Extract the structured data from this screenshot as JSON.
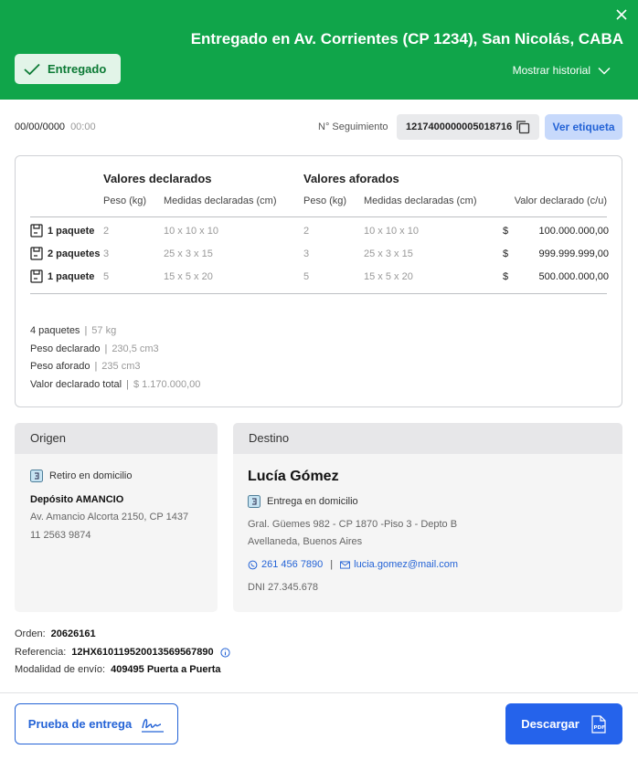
{
  "header": {
    "title": "Entregado en Av. Corrientes (CP 1234), San Nicolás, CABA",
    "status": "Entregado",
    "history_link": "Mostrar historial",
    "accent_color": "#10a54a"
  },
  "info": {
    "date": "00/00/0000",
    "time": "00:00",
    "tracking_label": "N° Seguimiento",
    "tracking_number": "1217400000005018716",
    "label_button": "Ver etiqueta"
  },
  "packages": {
    "group_declared": "Valores declarados",
    "group_appraised": "Valores aforados",
    "col_weight": "Peso (kg)",
    "col_dimensions": "Medidas declaradas (cm)",
    "col_weight_2": "Peso (kg)",
    "col_dimensions_2": "Medidas declaradas (cm)",
    "col_value": "Valor declarado (c/u)",
    "rows": [
      {
        "label": "1 paquete",
        "weight": "2",
        "dims": "10 x 10 x 10",
        "weight2": "2",
        "dims2": "10 x 10 x 10",
        "currency": "$",
        "value": "100.000.000,00"
      },
      {
        "label": "2 paquetes",
        "weight": "3",
        "dims": "25 x 3 x 15",
        "weight2": "3",
        "dims2": "25 x 3 x 15",
        "currency": "$",
        "value": "999.999.999,00"
      },
      {
        "label": "1 paquete",
        "weight": "5",
        "dims": "15 x 5 x 20",
        "weight2": "5",
        "dims2": "15 x 5 x 20",
        "currency": "$",
        "value": "500.000.000,00"
      }
    ],
    "summary": [
      {
        "label": "4 paquetes",
        "value": "57 kg"
      },
      {
        "label": "Peso declarado",
        "value": "230,5 cm3"
      },
      {
        "label": "Peso aforado",
        "value": "235 cm3"
      },
      {
        "label": "Valor declarado total",
        "value": "$ 1.170.000,00"
      }
    ]
  },
  "origin": {
    "title": "Origen",
    "type": "Retiro en domicilio",
    "name": "Depósito AMANCIO",
    "address": "Av. Amancio Alcorta 2150, CP 1437",
    "phone": "11 2563 9874"
  },
  "destination": {
    "title": "Destino",
    "name": "Lucía Gómez",
    "type": "Entrega en domicilio",
    "address_line1": "Gral. Güemes 982 - CP 1870 -Piso 3 - Depto B",
    "address_line2": "Avellaneda, Buenos Aires",
    "phone": "261 456 7890",
    "separator": "|",
    "email": "lucia.gomez@mail.com",
    "dni": "DNI 27.345.678"
  },
  "meta": {
    "order_label": "Orden:",
    "order_value": "20626161",
    "reference_label": "Referencia:",
    "reference_value": "12HX610119520013569567890",
    "shipping_label": "Modalidad de envío:",
    "shipping_value": "409495  Puerta a Puerta"
  },
  "footer": {
    "proof_button": "Prueba de entrega",
    "download_button": "Descargar"
  }
}
